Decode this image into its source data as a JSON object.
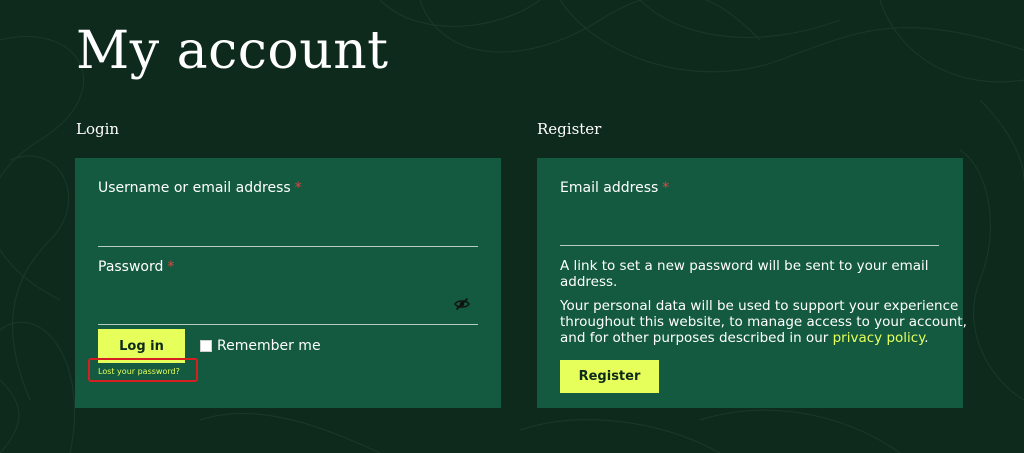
{
  "page": {
    "title": "My account"
  },
  "login": {
    "heading": "Login",
    "username_label": "Username or email address",
    "password_label": "Password",
    "required_marker": "*",
    "login_button": "Log in",
    "remember_label": "Remember me",
    "lost_password_link": "Lost your password?"
  },
  "register": {
    "heading": "Register",
    "email_label": "Email address",
    "required_marker": "*",
    "info_line1": "A link to set a new password will be sent to your email",
    "info_line2": "address.",
    "privacy_line1": "Your personal data will be used to support your experience",
    "privacy_line2": "throughout this website, to manage access to your account,",
    "privacy_line3_start": "and for other purposes described in our",
    "privacy_link": "privacy policy",
    "privacy_line3_end": ".",
    "register_button": "Register"
  },
  "colors": {
    "background": "#0d2a1c",
    "panel": "#135a40",
    "accent": "#e6ff5a",
    "required": "#e04646",
    "highlight_box": "#d42020"
  },
  "icons": {
    "password_toggle": "eye-slash-icon"
  }
}
